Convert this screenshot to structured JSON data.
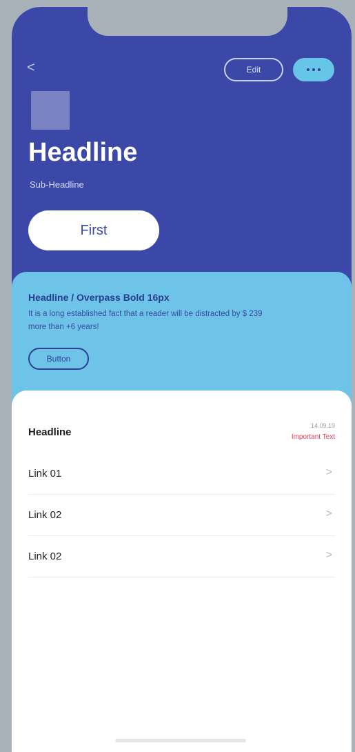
{
  "header": {
    "back_icon": "<",
    "edit_label": "Edit",
    "more_icon": "more-icon"
  },
  "hero": {
    "headline": "Headline",
    "subheadline": "Sub-Headline",
    "primary_button": "First"
  },
  "info_card": {
    "title": "Headline / Overpass Bold 16px",
    "body": "It is a long established fact that a reader will be distracted by $ 239 more than +6 years!",
    "button": "Button"
  },
  "list": {
    "header_title": "Headline",
    "header_date": "14.09.19",
    "header_note": "Important Text",
    "items": [
      {
        "label": "Link 01",
        "chevron": ">"
      },
      {
        "label": "Link 02",
        "chevron": ">"
      },
      {
        "label": "Link 02",
        "chevron": ">"
      }
    ]
  },
  "colors": {
    "primary": "#3b48a8",
    "accent": "#67c5e8",
    "card": "#6dc4e8",
    "alert": "#e0405a",
    "page_bg": "#aab2b9"
  }
}
